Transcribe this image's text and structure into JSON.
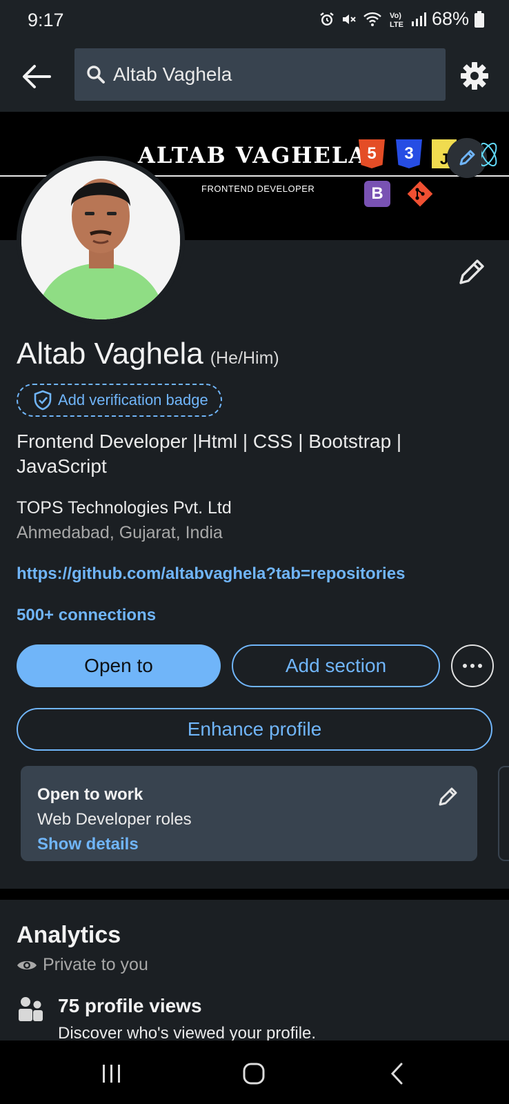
{
  "status_bar": {
    "time": "9:17",
    "battery": "68%",
    "icons": [
      "alarm-icon",
      "mute-icon",
      "wifi-icon",
      "volte-icon",
      "signal-icon",
      "battery-icon"
    ]
  },
  "top_bar": {
    "search_value": "Altab Vaghela"
  },
  "banner": {
    "name": "ALTAB VAGHELA",
    "subtitle": "FRONTEND DEVELOPER",
    "logos": [
      "5",
      "3",
      "J",
      "B"
    ]
  },
  "profile": {
    "name": "Altab Vaghela",
    "pronouns": "(He/Him)",
    "verification_label": "Add verification badge",
    "headline": "Frontend Developer |Html | CSS | Bootstrap | JavaScript",
    "company": "TOPS Technologies Pvt. Ltd",
    "location": "Ahmedabad, Gujarat, India",
    "website": "https://github.com/altabvaghela?tab=repositories",
    "connections": "500+ connections"
  },
  "actions": {
    "open_to": "Open to",
    "add_section": "Add section",
    "enhance_profile": "Enhance profile"
  },
  "open_to_work": {
    "title": "Open to work",
    "roles": "Web Developer roles",
    "show_details": "Show details"
  },
  "analytics": {
    "title": "Analytics",
    "privacy": "Private to you",
    "views": "75 profile views",
    "views_sub": "Discover who's viewed your profile."
  },
  "colors": {
    "accent": "#70b5f9",
    "background": "#1b1f23",
    "card": "#38434f"
  }
}
